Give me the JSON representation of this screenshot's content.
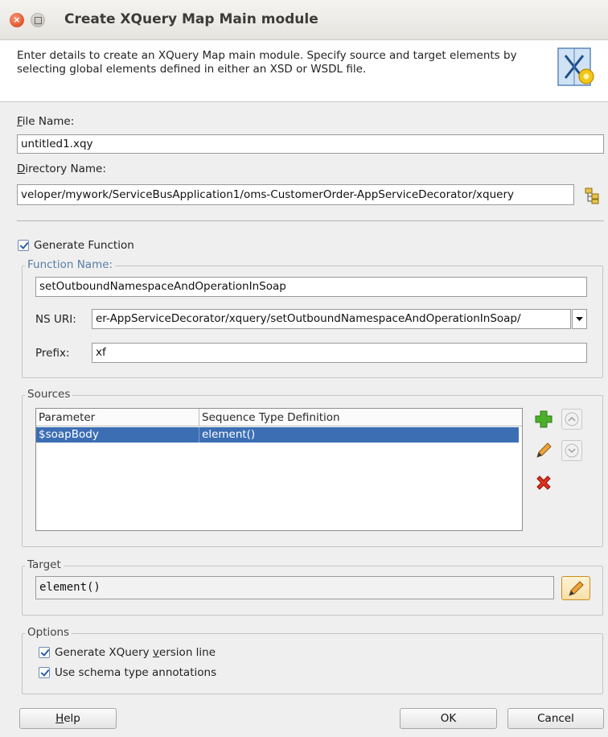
{
  "window": {
    "title": "Create XQuery Map Main module",
    "close_glyph": "×"
  },
  "header": {
    "description": "Enter details to create an XQuery Map main module. Specify source and target elements by selecting global elements defined in either an XSD or WSDL file.",
    "icon": "xquery-map-wizard-icon"
  },
  "file": {
    "label_mnemonic": "F",
    "label_rest": "ile Name:",
    "value": "untitled1.xqy"
  },
  "directory": {
    "label_mnemonic": "D",
    "label_rest": "irectory Name:",
    "value": "veloper/mywork/ServiceBusApplication1/oms-CustomerOrder-AppServiceDecorator/xquery",
    "browse_icon": "browse-folder-icon"
  },
  "generate_function": {
    "label": "Generate Function",
    "checked": true
  },
  "function": {
    "group_title": "Function Name:",
    "name_value": "setOutboundNamespaceAndOperationInSoap",
    "ns_uri_label": "NS URI:",
    "ns_uri_value": "er-AppServiceDecorator/xquery/setOutboundNamespaceAndOperationInSoap/",
    "prefix_label": "Prefix:",
    "prefix_value": "xf"
  },
  "sources": {
    "group_title": "Sources",
    "columns": [
      "Parameter",
      "Sequence Type Definition"
    ],
    "rows": [
      {
        "parameter": "$soapBody",
        "type": "element()",
        "selected": true
      }
    ],
    "buttons": [
      "add-icon",
      "edit-icon",
      "delete-icon",
      "move-up-icon",
      "move-down-icon"
    ]
  },
  "target": {
    "group_title": "Target",
    "value": "element()"
  },
  "options": {
    "group_title": "Options",
    "items": [
      {
        "label_pre": "Generate XQuery ",
        "label_mnemonic": "v",
        "label_post": "ersion line",
        "checked": true
      },
      {
        "label_pre": "Use schema type annotations",
        "label_mnemonic": "",
        "label_post": "",
        "checked": true
      }
    ]
  },
  "buttons": {
    "help_mnemonic": "H",
    "help_rest": "elp",
    "ok": "OK",
    "cancel": "Cancel"
  },
  "colors": {
    "selection": "#3c6eb4",
    "group_title": "#5a7da8",
    "close_button": "#e0542c"
  }
}
